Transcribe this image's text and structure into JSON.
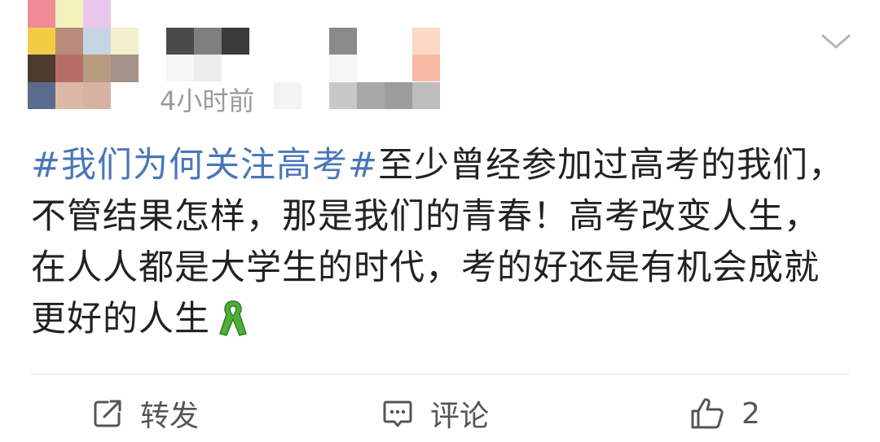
{
  "header": {
    "timestamp": "4小时前",
    "more_icon": "chevron-down-icon"
  },
  "post": {
    "topic": "#我们为何关注高考#",
    "text": "至少曾经参加过高考的我们，不管结果怎样，那是我们的青春！高考改变人生，在人人都是大学生的时代，考的好还是有机会成就更好的人生",
    "emoji_icon": "green-ribbon-icon"
  },
  "actions": {
    "repost": {
      "label": "转发",
      "icon": "share-icon"
    },
    "comment": {
      "label": "评论",
      "icon": "comment-icon"
    },
    "like": {
      "count": "2",
      "icon": "thumbs-up-icon"
    }
  },
  "colors": {
    "topic": "#4a77b8",
    "meta": "#9a9a9a",
    "text": "#222222",
    "action": "#555555"
  }
}
